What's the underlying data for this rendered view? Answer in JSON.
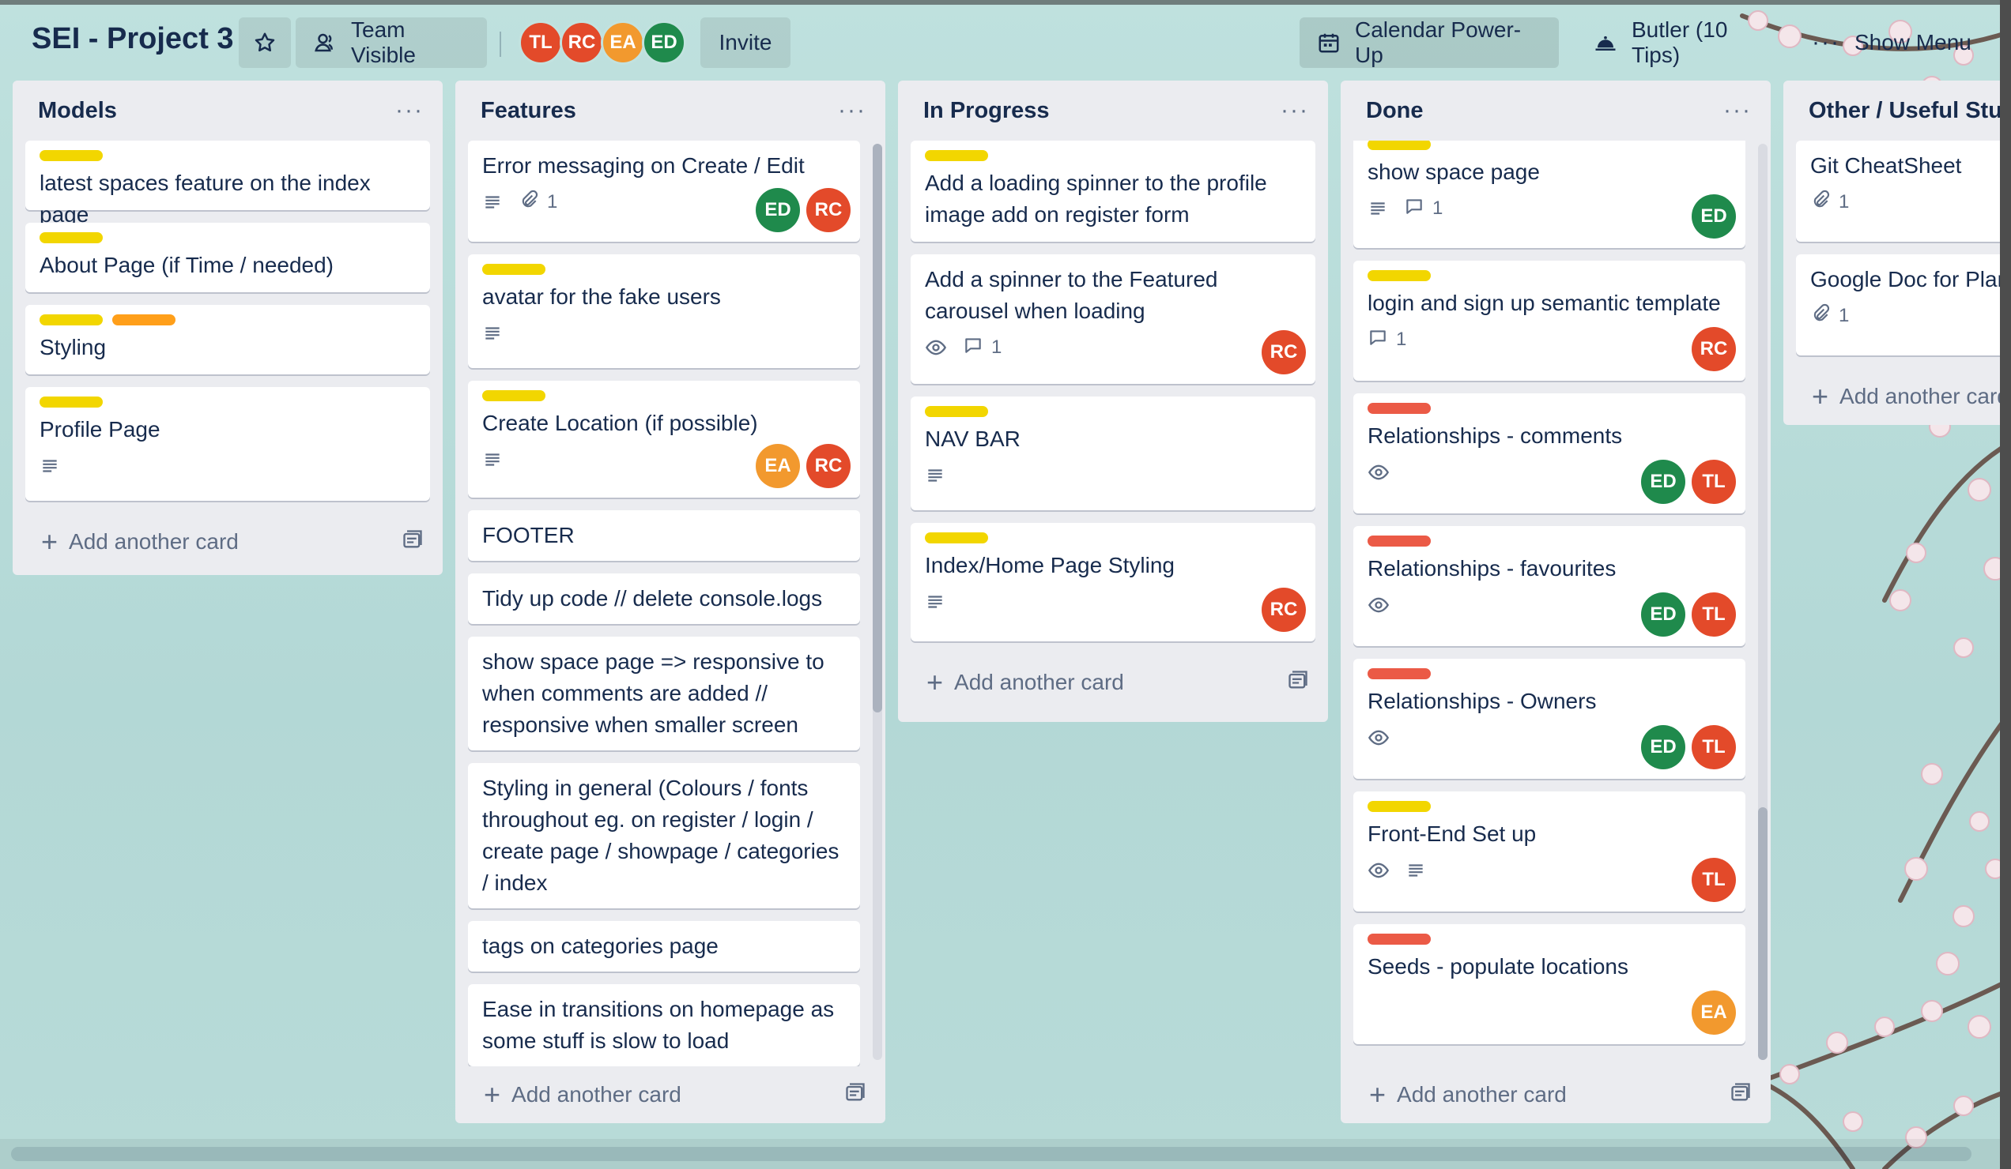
{
  "header": {
    "board_title": "SEI - Project 3",
    "visibility_label": "Team Visible",
    "invite_label": "Invite",
    "members": [
      {
        "initials": "TL",
        "color": "#e34a2a"
      },
      {
        "initials": "RC",
        "color": "#e34a2a"
      },
      {
        "initials": "EA",
        "color": "#f2992e"
      },
      {
        "initials": "ED",
        "color": "#1f8a4c"
      }
    ],
    "calendar_label": "Calendar Power-Up",
    "butler_label": "Butler (10 Tips)",
    "show_menu_label": "Show Menu"
  },
  "colors": {
    "yellow": "#f2d600",
    "orange": "#ff9f1a",
    "red": "#eb5a46",
    "av_red": "#e34a2a",
    "av_green": "#1f8a4c",
    "av_orange": "#f2992e"
  },
  "add_card_label": "Add another card",
  "lists": {
    "models": {
      "title": "Models",
      "cards": [
        {
          "title": "latest spaces feature on the index page"
        },
        {
          "title": "About Page (if Time / needed)"
        },
        {
          "title": "Styling"
        },
        {
          "title": "Profile Page"
        }
      ]
    },
    "features": {
      "title": "Features",
      "cards": [
        {
          "title": "Error messaging on Create / Edit",
          "attachments": "1"
        },
        {
          "title": "avatar for the fake users"
        },
        {
          "title": "Create Location (if possible)"
        },
        {
          "title": "FOOTER"
        },
        {
          "title": "Tidy up code // delete console.logs"
        },
        {
          "title": "show space page => responsive to when comments are added // responsive when smaller screen"
        },
        {
          "title": "Styling in general (Colours / fonts throughout eg. on register / login / create page / showpage / categories / index"
        },
        {
          "title": "tags on categories page"
        },
        {
          "title": "Ease in transitions on homepage as some stuff is slow to load"
        }
      ]
    },
    "in_progress": {
      "title": "In Progress",
      "cards": [
        {
          "title": "Add a loading spinner to the profile image add on register form"
        },
        {
          "title": "Add a spinner to the Featured carousel when loading",
          "comments": "1"
        },
        {
          "title": "NAV BAR"
        },
        {
          "title": "Index/Home Page Styling"
        }
      ]
    },
    "done": {
      "title": "Done",
      "cards": [
        {
          "title": "show space page",
          "comments": "1"
        },
        {
          "title": "login and sign up semantic template",
          "comments": "1"
        },
        {
          "title": "Relationships - comments"
        },
        {
          "title": "Relationships - favourites"
        },
        {
          "title": "Relationships - Owners"
        },
        {
          "title": "Front-End Set up"
        },
        {
          "title": "Seeds - populate locations"
        }
      ]
    },
    "other": {
      "title": "Other / Useful Stuff",
      "cards": [
        {
          "title": "Git CheatSheet",
          "attachments": "1"
        },
        {
          "title": "Google Doc for Planning",
          "attachments": "1"
        }
      ]
    }
  }
}
